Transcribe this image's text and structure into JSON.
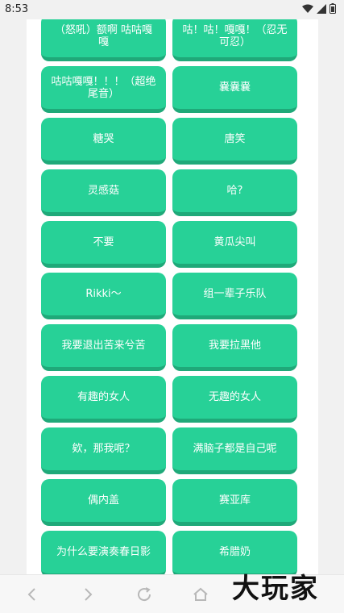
{
  "status_bar": {
    "time": "8:53",
    "icons": [
      "wifi-icon",
      "signal-icon",
      "battery-icon"
    ]
  },
  "buttons": [
    {
      "label": "（怒吼）额啊 咕咕嘎嘎"
    },
    {
      "label": "咕！咕！嘎嘎！（忍无可忍）"
    },
    {
      "label": "咕咕嘎嘎！！！（超绝尾音）"
    },
    {
      "label": "嚢嚢嚢"
    },
    {
      "label": "糖哭"
    },
    {
      "label": "唐笑"
    },
    {
      "label": "灵感菇"
    },
    {
      "label": "哈?"
    },
    {
      "label": "不要"
    },
    {
      "label": "黄瓜尖叫"
    },
    {
      "label": "Rikki～"
    },
    {
      "label": "组一辈子乐队"
    },
    {
      "label": "我要退出苦来兮苦"
    },
    {
      "label": "我要拉黑他"
    },
    {
      "label": "有趣的女人"
    },
    {
      "label": "无趣的女人"
    },
    {
      "label": "欸，那我呢？"
    },
    {
      "label": "满脑子都是自己呢"
    },
    {
      "label": "偶内盖"
    },
    {
      "label": "赛亚库"
    },
    {
      "label": "为什么要演奏春日影"
    },
    {
      "label": "希腊奶"
    }
  ],
  "nav_bar": {
    "icons": [
      "back-icon",
      "forward-icon",
      "refresh-icon",
      "home-icon"
    ]
  },
  "watermark": "大玩家",
  "colors": {
    "button": "#27d197",
    "button_shadow": "#1fa979",
    "background": "#f1f1f1"
  }
}
